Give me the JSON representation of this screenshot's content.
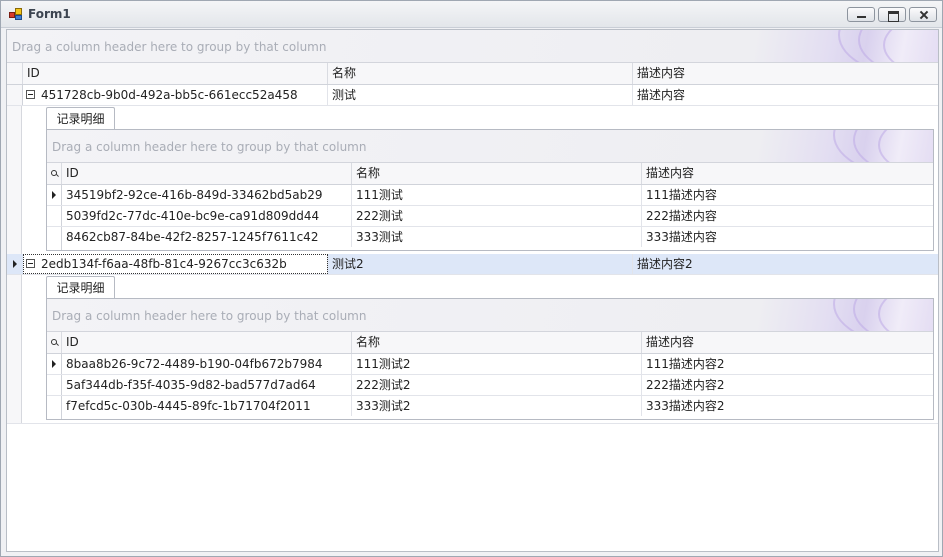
{
  "window": {
    "title": "Form1"
  },
  "group_panel_hint": "Drag a column header here to group by that column",
  "columns": [
    "ID",
    "名称",
    "描述内容"
  ],
  "rows": [
    {
      "id": "451728cb-9b0d-492a-bb5c-661ecc52a458",
      "name": "测试",
      "desc": "描述内容",
      "detail": {
        "tab_label": "记录明细",
        "group_hint": "Drag a column header here to group by that column",
        "columns": [
          "ID",
          "名称",
          "描述内容"
        ],
        "rows": [
          {
            "id": "34519bf2-92ce-416b-849d-33462bd5ab29",
            "name": "111测试",
            "desc": "111描述内容"
          },
          {
            "id": "5039fd2c-77dc-410e-bc9e-ca91d809dd44",
            "name": "222测试",
            "desc": "222描述内容"
          },
          {
            "id": "8462cb87-84be-42f2-8257-1245f7611c42",
            "name": "333测试",
            "desc": "333描述内容"
          }
        ]
      }
    },
    {
      "id": "2edb134f-f6aa-48fb-81c4-9267cc3c632b",
      "name": "测试2",
      "desc": "描述内容2",
      "detail": {
        "tab_label": "记录明细",
        "group_hint": "Drag a column header here to group by that column",
        "columns": [
          "ID",
          "名称",
          "描述内容"
        ],
        "rows": [
          {
            "id": "8baa8b26-9c72-4489-b190-04fb672b7984",
            "name": "111测试2",
            "desc": "111描述内容2"
          },
          {
            "id": "5af344db-f35f-4035-9d82-bad577d7ad64",
            "name": "222测试2",
            "desc": "222描述内容2"
          },
          {
            "id": "f7efcd5c-030b-4445-89fc-1b71704f2011",
            "name": "333测试2",
            "desc": "333描述内容2"
          }
        ]
      }
    }
  ]
}
